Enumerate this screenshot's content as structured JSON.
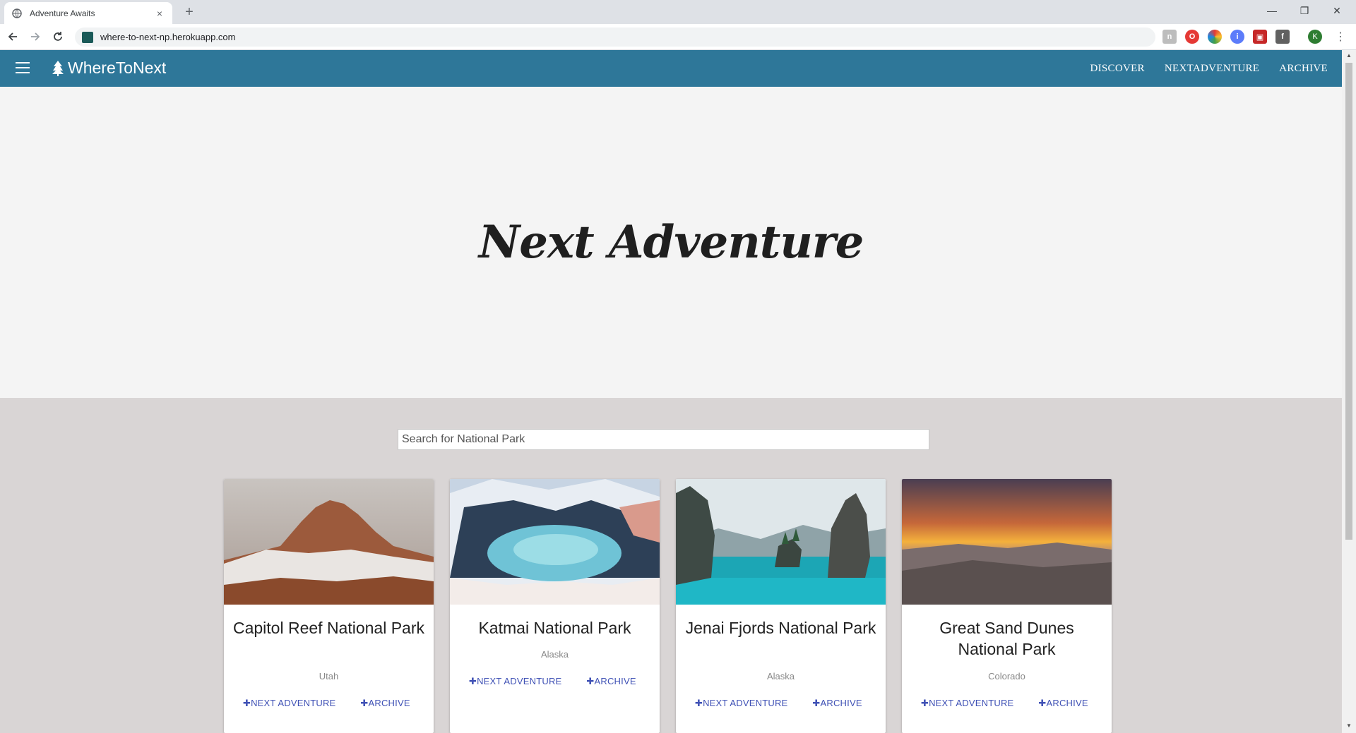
{
  "browser": {
    "tab_title": "Adventure Awaits",
    "tab_close": "×",
    "new_tab": "+",
    "url": "where-to-next-np.herokuapp.com",
    "profile_initial": "K",
    "win_minimize": "—",
    "win_restore": "❐",
    "win_close": "✕"
  },
  "app": {
    "brand": "WhereToNext",
    "nav": [
      "DISCOVER",
      "NEXTADVENTURE",
      "ARCHIVE"
    ],
    "hero_title": "Next Adventure",
    "search_placeholder": "Search for National Park"
  },
  "cards": [
    {
      "title": "Capitol Reef National Park",
      "state": "Utah",
      "btn1": "✚NEXT ADVENTURE",
      "btn2": "✚ARCHIVE"
    },
    {
      "title": "Katmai National Park",
      "state": "Alaska",
      "btn1": "✚NEXT ADVENTURE",
      "btn2": "✚ARCHIVE"
    },
    {
      "title": "Jenai Fjords National Park",
      "state": "Alaska",
      "btn1": "✚NEXT ADVENTURE",
      "btn2": "✚ARCHIVE"
    },
    {
      "title": "Great Sand Dunes National Park",
      "state": "Colorado",
      "btn1": "✚NEXT ADVENTURE",
      "btn2": "✚ARCHIVE"
    }
  ],
  "colors": {
    "nav_bg": "#2e7799",
    "hero_bg": "#f4f4f4",
    "page_bg": "#d9d5d5",
    "button_text": "#3f51b5"
  }
}
